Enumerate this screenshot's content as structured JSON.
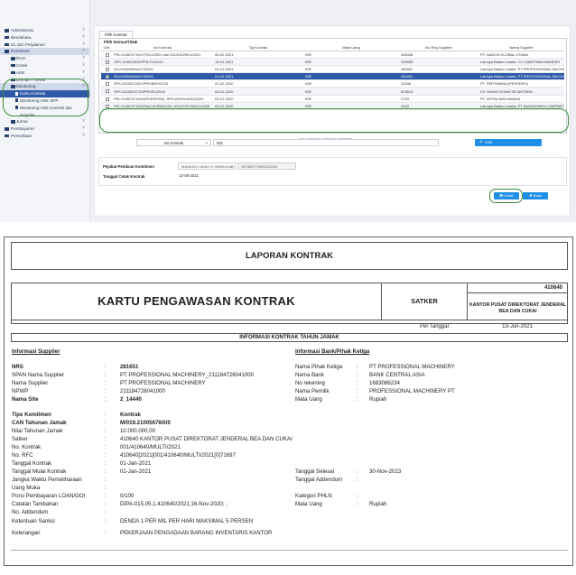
{
  "sidebar": {
    "items": [
      {
        "label": "Administrasi",
        "chev": "˅"
      },
      {
        "label": "Bendahara",
        "chev": "˅"
      },
      {
        "label": "DL dan Perjalanan",
        "chev": "˅"
      },
      {
        "label": "Komitmen",
        "chev": "˄"
      },
      {
        "label": "RUH",
        "chev": "˅"
      },
      {
        "label": "Cetak",
        "chev": "˅"
      },
      {
        "label": "ADK",
        "chev": "˅"
      },
      {
        "label": "Domain / Revisi",
        "chev": "˅"
      },
      {
        "label": "Monitoring",
        "chev": "˄"
      },
      {
        "label": "Kartu Kontrak"
      },
      {
        "label": "Monitoring ADK SPP"
      },
      {
        "label": "Monitoring ADK Kontrak dan"
      },
      {
        "label": "Supplier"
      },
      {
        "label": "Jurnal",
        "chev": "˅"
      },
      {
        "label": "Pembayaran",
        "chev": "˅"
      },
      {
        "label": "Persediaan",
        "chev": "˅"
      }
    ]
  },
  "main": {
    "tab_label": "Pilih Kontrak",
    "select_all_label": "Pilih Semua/Tidak",
    "columns": [
      "Cek",
      "No Kontrak",
      "Tgl Kontrak",
      "Mata Uang",
      "No Reg Supplier",
      "Nama Supplier"
    ],
    "rows": [
      [
        "",
        "PRJ-01/BC0715-HTKOJ/2021 dan 001/KDJ/SK1/2021",
        "05-02-2021",
        "IDR",
        "345335",
        "PT. NADIYA GLOBAL UTAMA"
      ],
      [
        "",
        "SPK-01/BC0515/PPK/TU/2021",
        "15-01-2021",
        "IDR",
        "299999",
        "Lainnya Badan Usaha: CV GABETAMA MANDIRI"
      ],
      [
        "",
        "001/410640/MULTI/2021",
        "01-01-2021",
        "IDR",
        "281651",
        "Lainnya Badan Usaha: PT PROFESSIONAL MACHINERY"
      ],
      [
        "✓",
        "001/410640/MULTI/2021",
        "01-01-2021",
        "IDR",
        "281651",
        "Lainnya Badan Usaha: PT PROFESSIONAL MACHINERY"
      ],
      [
        "",
        "SPK-001/BC1001/PPK/BEH/2020",
        "01-02-2020",
        "IDR",
        "13346",
        "PT. PERTAMINA (PERSERO)"
      ],
      [
        "",
        "SPK-001/BC0715/PPK/RL/2020",
        "03-01-2020",
        "IDR",
        "813613",
        "CV. RANGI SITAM SEJAHTERA"
      ],
      [
        "",
        "PRJ-01/BC0715/SERVER/2020, SPK/2020/1/W31/2020",
        "03-01-2020",
        "IDR",
        "2753",
        "PT. WITRA WIDYAMAYA"
      ],
      [
        "",
        "PRJ-01/BC0715/ORACLE/SW/2020, 001/HYPC/WD/1/2020",
        "03-01-2020",
        "IDR",
        "2003",
        "Lainnya Badan Usaha: PT NUSANTARA COMPNET INTEGR..."
      ]
    ],
    "pager": {
      "first": "«",
      "prev": "‹",
      "page": "1",
      "next": "›",
      "last": "»",
      "page_size": "10 ⌄"
    },
    "search": {
      "field": "No Kontrak",
      "value": "001",
      "button": "🔍 Cari"
    },
    "pejabat_label": "Pejabat Pembuat Komitmen",
    "pejabat_name": "MANDIDO NINDYO WARDONO",
    "pejabat_nip": "197305771992121002",
    "tanggal_label": "Tanggal Cetak Kontrak",
    "tanggal_value": "13-06-2021",
    "cetak_label": "🖶 Cetak",
    "batal_label": "✖ Batal"
  },
  "report": {
    "title": "LAPORAN KONTRAK",
    "kartu_title": "KARTU PENGAWASAN KONTRAK",
    "satker_label": "SATKER",
    "satker_code": "410640",
    "satker_name": "KANTOR PUSAT DIREKTORAT JENDERAL BEA DAN CUKAI",
    "per_tanggal_label": "Per Tanggal :",
    "per_tanggal_value": "13-Jun-2021",
    "info_heading": "INFORMASI KONTRAK TAHUN JAMAK",
    "supplier_heading": "Informasi Supplier",
    "bank_heading": "Informasi Bank/Pihak Ketiga",
    "left": [
      {
        "label": "NRS",
        "value": "281651",
        "bold": true
      },
      {
        "label": "SPAN Nama Supplier",
        "value": "PT PROFESSIONAL MACHINERY_211184726041000"
      },
      {
        "label": "Nama Supplier",
        "value": "PT PROFESSIONAL MACHINERY"
      },
      {
        "label": "NPWP",
        "value": "211184726041000"
      },
      {
        "label": "Nama Site",
        "value": "2_14440",
        "bold": true
      },
      {
        "label": "Tipe Komitmen",
        "value": "Kontrak",
        "bold": true
      },
      {
        "label": "CAN Tahunan Jamak",
        "value": "M/019.21005678/0/0",
        "bold": true
      },
      {
        "label": "Nilai Tahunan Jamak",
        "value": "10.000.000,00"
      },
      {
        "label": "Satker",
        "value": "410640 KANTOR PUSAT DIREKTORAT JENDERAL BEA DAN CUKAI"
      },
      {
        "label": "No. Kontrak",
        "value": "001/410640/MULTI/2021"
      },
      {
        "label": "No. RFC",
        "value": "410640[2021]001/410640/MULTI/2021[0]71697"
      },
      {
        "label": "Tanggal Kontrak",
        "value": "01-Jan-2021"
      },
      {
        "label": "Tanggal Mulai Kontrak",
        "value": "01-Jan-2021"
      },
      {
        "label": "Jangka Waktu Pemeliharaan",
        "value": ""
      },
      {
        "label": "Uang Muka",
        "value": ""
      },
      {
        "label": "Porsi Pembayaran LOAN/GOI",
        "value": "0/100"
      },
      {
        "label": "Catatan Tambahan",
        "value": "DIPA-015.05.1.410640/2021;16-Nov-2020; ;"
      },
      {
        "label": "No. Addendum",
        "value": ""
      },
      {
        "label": "Ketentuan Sanksi",
        "value": "DENDA 1 PER MIL PER HARI MAKSIMAL 5 PERSEN"
      },
      {
        "label": "Keterangan",
        "value": "PEKERJAAN PENGADAAN BARANG INVENTARIS KANTOR"
      }
    ],
    "right": [
      {
        "label": "Nama Pihak Ketiga",
        "value": "PT PROFESSIONAL MACHINERY"
      },
      {
        "label": "Nama Bank",
        "value": "BANK CENTRAL ASIA"
      },
      {
        "label": "No rekening",
        "value": "1683086234"
      },
      {
        "label": "Nama Pemilik",
        "value": "PROFESSIONAL MACHINERY PT"
      },
      {
        "label": "Mata Uang",
        "value": "Rupiah"
      }
    ],
    "right2": [
      {
        "label": "Tanggal Selesai",
        "value": "30-Nov-2023"
      },
      {
        "label": "Tanggal Addendum",
        "value": ""
      },
      {
        "label": "Kategori PHLN",
        "value": ""
      },
      {
        "label": "Mata Uang",
        "value": "Rupiah"
      }
    ],
    "colon": ":"
  }
}
